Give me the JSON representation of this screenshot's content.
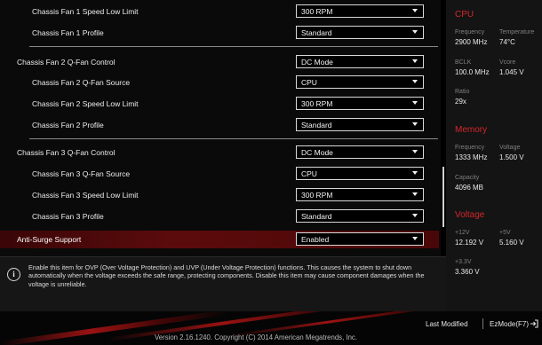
{
  "settings": {
    "fan1_speed_low_limit": {
      "label": "Chassis Fan 1 Speed Low Limit",
      "value": "300 RPM"
    },
    "fan1_profile": {
      "label": "Chassis Fan 1 Profile",
      "value": "Standard"
    },
    "fan2_qfan_control": {
      "label": "Chassis Fan 2 Q-Fan Control",
      "value": "DC Mode"
    },
    "fan2_qfan_source": {
      "label": "Chassis Fan 2 Q-Fan Source",
      "value": "CPU"
    },
    "fan2_speed_low_limit": {
      "label": "Chassis Fan 2 Speed Low Limit",
      "value": "300 RPM"
    },
    "fan2_profile": {
      "label": "Chassis Fan 2 Profile",
      "value": "Standard"
    },
    "fan3_qfan_control": {
      "label": "Chassis Fan 3 Q-Fan Control",
      "value": "DC Mode"
    },
    "fan3_qfan_source": {
      "label": "Chassis Fan 3 Q-Fan Source",
      "value": "CPU"
    },
    "fan3_speed_low_limit": {
      "label": "Chassis Fan 3 Speed Low Limit",
      "value": "300 RPM"
    },
    "fan3_profile": {
      "label": "Chassis Fan 3 Profile",
      "value": "Standard"
    },
    "anti_surge": {
      "label": "Anti-Surge Support",
      "value": "Enabled"
    }
  },
  "help": {
    "icon": "info-icon",
    "icon_glyph": "i",
    "text": "Enable this item for OVP (Over Voltage Protection) and UVP (Under Voltage Protection) functions. This causes the system to shut down automatically when the voltage exceeds the safe range, protecting components. Disable this item may cause component damages when the voltage is unreliable."
  },
  "monitor": {
    "cpu": {
      "title": "CPU",
      "frequency_label": "Frequency",
      "frequency_value": "2900 MHz",
      "temperature_label": "Temperature",
      "temperature_value": "74°C",
      "bclk_label": "BCLK",
      "bclk_value": "100.0 MHz",
      "vcore_label": "Vcore",
      "vcore_value": "1.045 V",
      "ratio_label": "Ratio",
      "ratio_value": "29x"
    },
    "memory": {
      "title": "Memory",
      "frequency_label": "Frequency",
      "frequency_value": "1333 MHz",
      "voltage_label": "Voltage",
      "voltage_value": "1.500 V",
      "capacity_label": "Capacity",
      "capacity_value": "4096 MB"
    },
    "voltage": {
      "title": "Voltage",
      "v12_label": "+12V",
      "v12_value": "12.192 V",
      "v5_label": "+5V",
      "v5_value": "5.160 V",
      "v33_label": "+3.3V",
      "v33_value": "3.360 V"
    }
  },
  "footer": {
    "version": "Version 2.16.1240. Copyright (C) 2014 American Megatrends, Inc.",
    "last_modified": "Last Modified",
    "ezmode": "EzMode(F7)",
    "exit_icon": "exit-arrow-icon"
  },
  "colors": {
    "accent_red": "#d3262b",
    "selected_row": "#5c0b0c",
    "background": "#0a0a0a"
  }
}
